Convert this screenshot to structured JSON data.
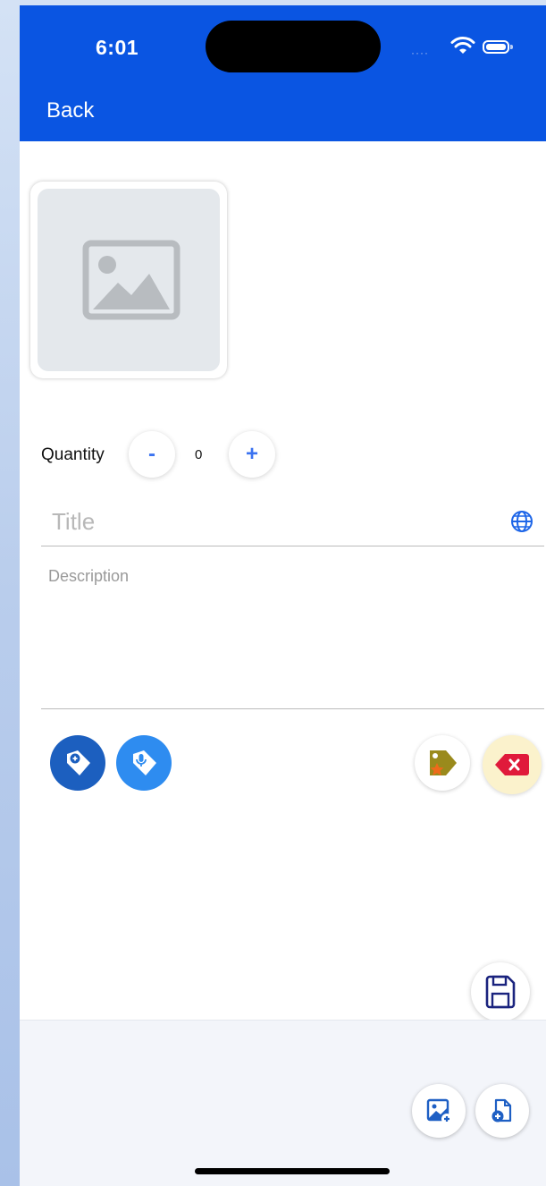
{
  "status_bar": {
    "time": "6:01"
  },
  "nav": {
    "back_label": "Back"
  },
  "quantity": {
    "label": "Quantity",
    "minus_label": "-",
    "value": "0",
    "plus_label": "+"
  },
  "form": {
    "title_placeholder": "Title",
    "description_placeholder": "Description"
  },
  "colors": {
    "header": "#0a55e2",
    "accent": "#3b73f0",
    "save_icon": "#1a237e"
  },
  "icons": {
    "photo_placeholder": "image-placeholder-icon",
    "globe": "globe-icon",
    "add_tag": "tag-add-icon",
    "voice_tag": "tag-voice-icon",
    "favorite_tag": "tag-star-icon",
    "delete": "delete-icon",
    "save": "save-icon",
    "add_image": "add-image-icon",
    "add_document": "add-document-icon"
  }
}
